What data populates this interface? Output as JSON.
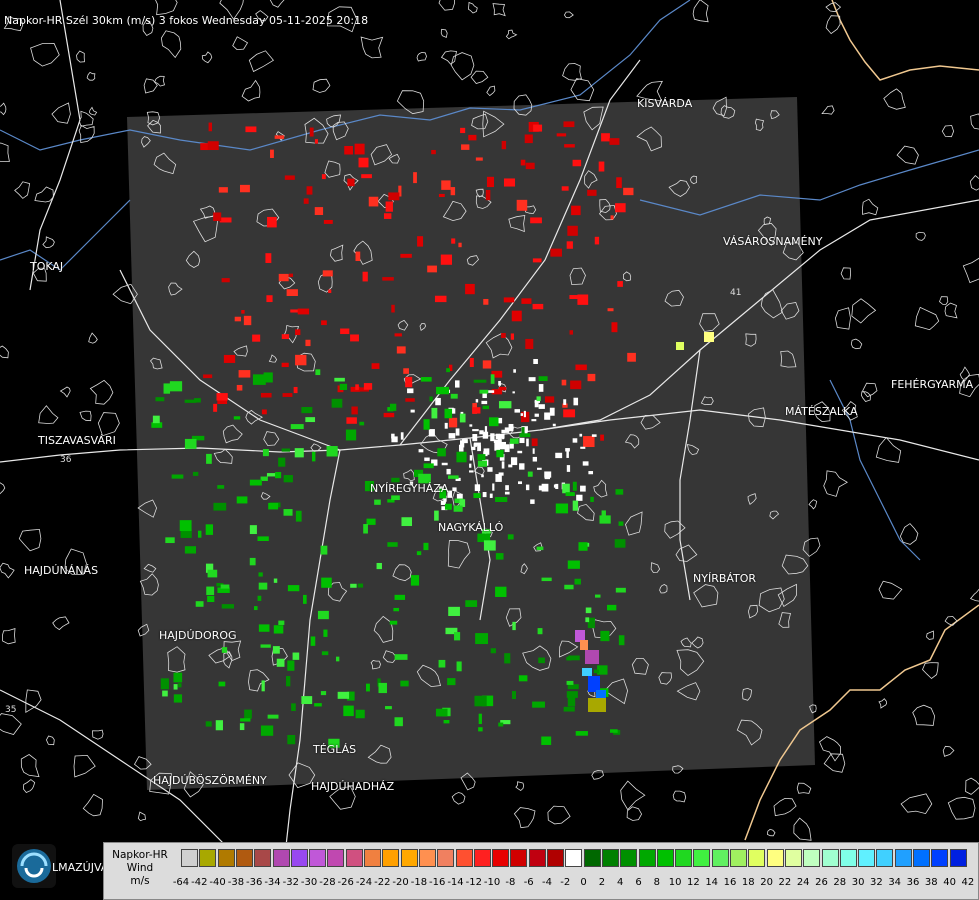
{
  "header": {
    "title": "Napkor-HR Szél 30km (m/s) 3 fokos Wednesday 05-11-2025 20:18"
  },
  "cities": [
    {
      "id": "kisvarda",
      "label": "KISVÁRDA"
    },
    {
      "id": "vasarosnameny",
      "label": "VÁSÁROSNAMÉNY"
    },
    {
      "id": "tokaj",
      "label": "TOKAJ"
    },
    {
      "id": "fehergyarmat",
      "label": "FEHÉRGYARMA"
    },
    {
      "id": "mateszalka",
      "label": "MÁTÉSZALKA"
    },
    {
      "id": "tiszavasvari",
      "label": "TISZAVASVÁRI"
    },
    {
      "id": "nyiregyhaza",
      "label": "NYÍREGYHÁZA"
    },
    {
      "id": "nagykallo",
      "label": "NAGYKÁLLÓ"
    },
    {
      "id": "hajdunanas",
      "label": "HAJDÚNÁNÁS"
    },
    {
      "id": "nyirbator",
      "label": "NYÍRBÁTOR"
    },
    {
      "id": "hajdudorog",
      "label": "HAJDÚDOROG"
    },
    {
      "id": "teglas",
      "label": "TÉGLÁS"
    },
    {
      "id": "hajduboszormeny",
      "label": "HAJDÚBÖSZÖRMÉNY"
    },
    {
      "id": "hajduhadhaz",
      "label": "HAJDÚHADHÁZ"
    }
  ],
  "road_numbers": [
    "41",
    "35",
    "36"
  ],
  "logo": {
    "text": "LMAZÚJVÁR"
  },
  "legend": {
    "title": [
      "Napkor-HR",
      "Wind",
      "m/s"
    ],
    "values": [
      -64,
      -42,
      -40,
      -38,
      -36,
      -34,
      -32,
      -30,
      -28,
      -26,
      -24,
      -22,
      -20,
      -18,
      -16,
      -14,
      -12,
      -10,
      -8,
      -6,
      -4,
      -2,
      0,
      2,
      4,
      6,
      8,
      10,
      12,
      14,
      16,
      18,
      20,
      22,
      24,
      26,
      28,
      30,
      32,
      34,
      36,
      38,
      40,
      42
    ],
    "colors": [
      "#d0d0d0",
      "#a8a800",
      "#b07a00",
      "#b05a10",
      "#a84848",
      "#b048b0",
      "#9848f0",
      "#c058d8",
      "#c048b0",
      "#d05080",
      "#f08040",
      "#ffa000",
      "#ffa800",
      "#ff9050",
      "#f08060",
      "#ff5030",
      "#ff2020",
      "#e80000",
      "#d00000",
      "#c00010",
      "#b00000",
      "#ffffff",
      "#006800",
      "#008000",
      "#009000",
      "#00a800",
      "#00c000",
      "#20d820",
      "#40f040",
      "#60f060",
      "#a0f060",
      "#e0ff60",
      "#ffff80",
      "#e0ffa0",
      "#c0ffc0",
      "#a0ffd0",
      "#80ffe8",
      "#60f0ff",
      "#40d0ff",
      "#20a0ff",
      "#0070ff",
      "#0040ff",
      "#0020e0"
    ]
  }
}
